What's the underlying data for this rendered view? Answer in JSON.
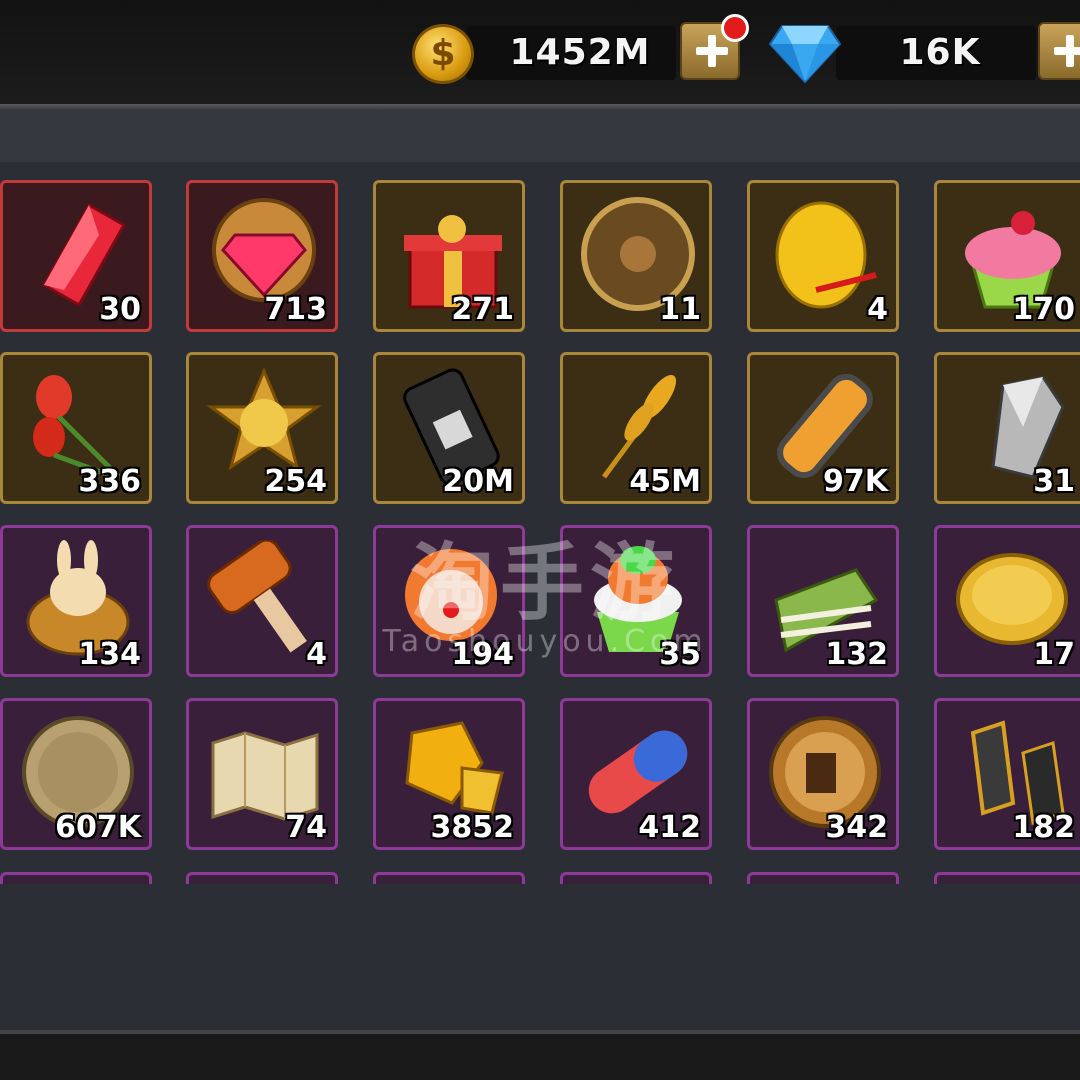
{
  "currency": {
    "gold": {
      "value": "1452M",
      "icon": "gold-coin-icon"
    },
    "diamonds": {
      "value": "16K",
      "icon": "blue-diamond-icon"
    }
  },
  "inventory": [
    {
      "name": "red-crystal",
      "qty": "30",
      "rarity": "red",
      "icon": "red-crystal-icon"
    },
    {
      "name": "ruby-emblem",
      "qty": "713",
      "rarity": "red",
      "icon": "ruby-emblem-icon"
    },
    {
      "name": "gift-box",
      "qty": "271",
      "rarity": "gold",
      "icon": "gift-box-icon"
    },
    {
      "name": "wheel-board",
      "qty": "11",
      "rarity": "gold",
      "icon": "wheel-board-icon"
    },
    {
      "name": "golden-egg",
      "qty": "4",
      "rarity": "gold",
      "icon": "golden-egg-icon"
    },
    {
      "name": "cupcake",
      "qty": "170",
      "rarity": "gold",
      "icon": "cupcake-icon"
    },
    {
      "name": "tulip-bouquet",
      "qty": "336",
      "rarity": "gold",
      "icon": "tulip-icon"
    },
    {
      "name": "star-medal",
      "qty": "254",
      "rarity": "gold",
      "icon": "star-medal-icon"
    },
    {
      "name": "oil-barrel",
      "qty": "20M",
      "rarity": "gold",
      "icon": "oil-barrel-icon"
    },
    {
      "name": "wheat",
      "qty": "45M",
      "rarity": "gold",
      "icon": "wheat-icon"
    },
    {
      "name": "energy-capsule",
      "qty": "97K",
      "rarity": "gold",
      "icon": "energy-capsule-icon"
    },
    {
      "name": "silver-crystal",
      "qty": "31",
      "rarity": "gold",
      "icon": "silver-crystal-icon"
    },
    {
      "name": "bunny-basket",
      "qty": "134",
      "rarity": "purple",
      "icon": "bunny-basket-icon"
    },
    {
      "name": "wooden-hammer",
      "qty": "4",
      "rarity": "purple",
      "icon": "hammer-icon"
    },
    {
      "name": "clown",
      "qty": "194",
      "rarity": "purple",
      "icon": "clown-icon"
    },
    {
      "name": "rainbow-cupcake",
      "qty": "35",
      "rarity": "purple",
      "icon": "rainbow-cupcake-icon"
    },
    {
      "name": "matcha-cake",
      "qty": "132",
      "rarity": "purple",
      "icon": "cake-slice-icon"
    },
    {
      "name": "clover-coin",
      "qty": "17",
      "rarity": "purple",
      "icon": "clover-coin-icon"
    },
    {
      "name": "laurel-coin",
      "qty": "607K",
      "rarity": "purple",
      "icon": "laurel-coin-icon"
    },
    {
      "name": "world-map",
      "qty": "74",
      "rarity": "purple",
      "icon": "map-icon"
    },
    {
      "name": "gold-nuggets",
      "qty": "3852",
      "rarity": "purple",
      "icon": "gold-nugget-icon"
    },
    {
      "name": "dna-capsule",
      "qty": "412",
      "rarity": "purple",
      "icon": "dna-pill-icon"
    },
    {
      "name": "beer-coin",
      "qty": "342",
      "rarity": "purple",
      "icon": "beer-coin-icon"
    },
    {
      "name": "dark-crystals",
      "qty": "182",
      "rarity": "purple",
      "icon": "dark-crystal-icon"
    }
  ],
  "watermark": {
    "cn": "淘手游",
    "en": "Taoshouyou.Com"
  }
}
